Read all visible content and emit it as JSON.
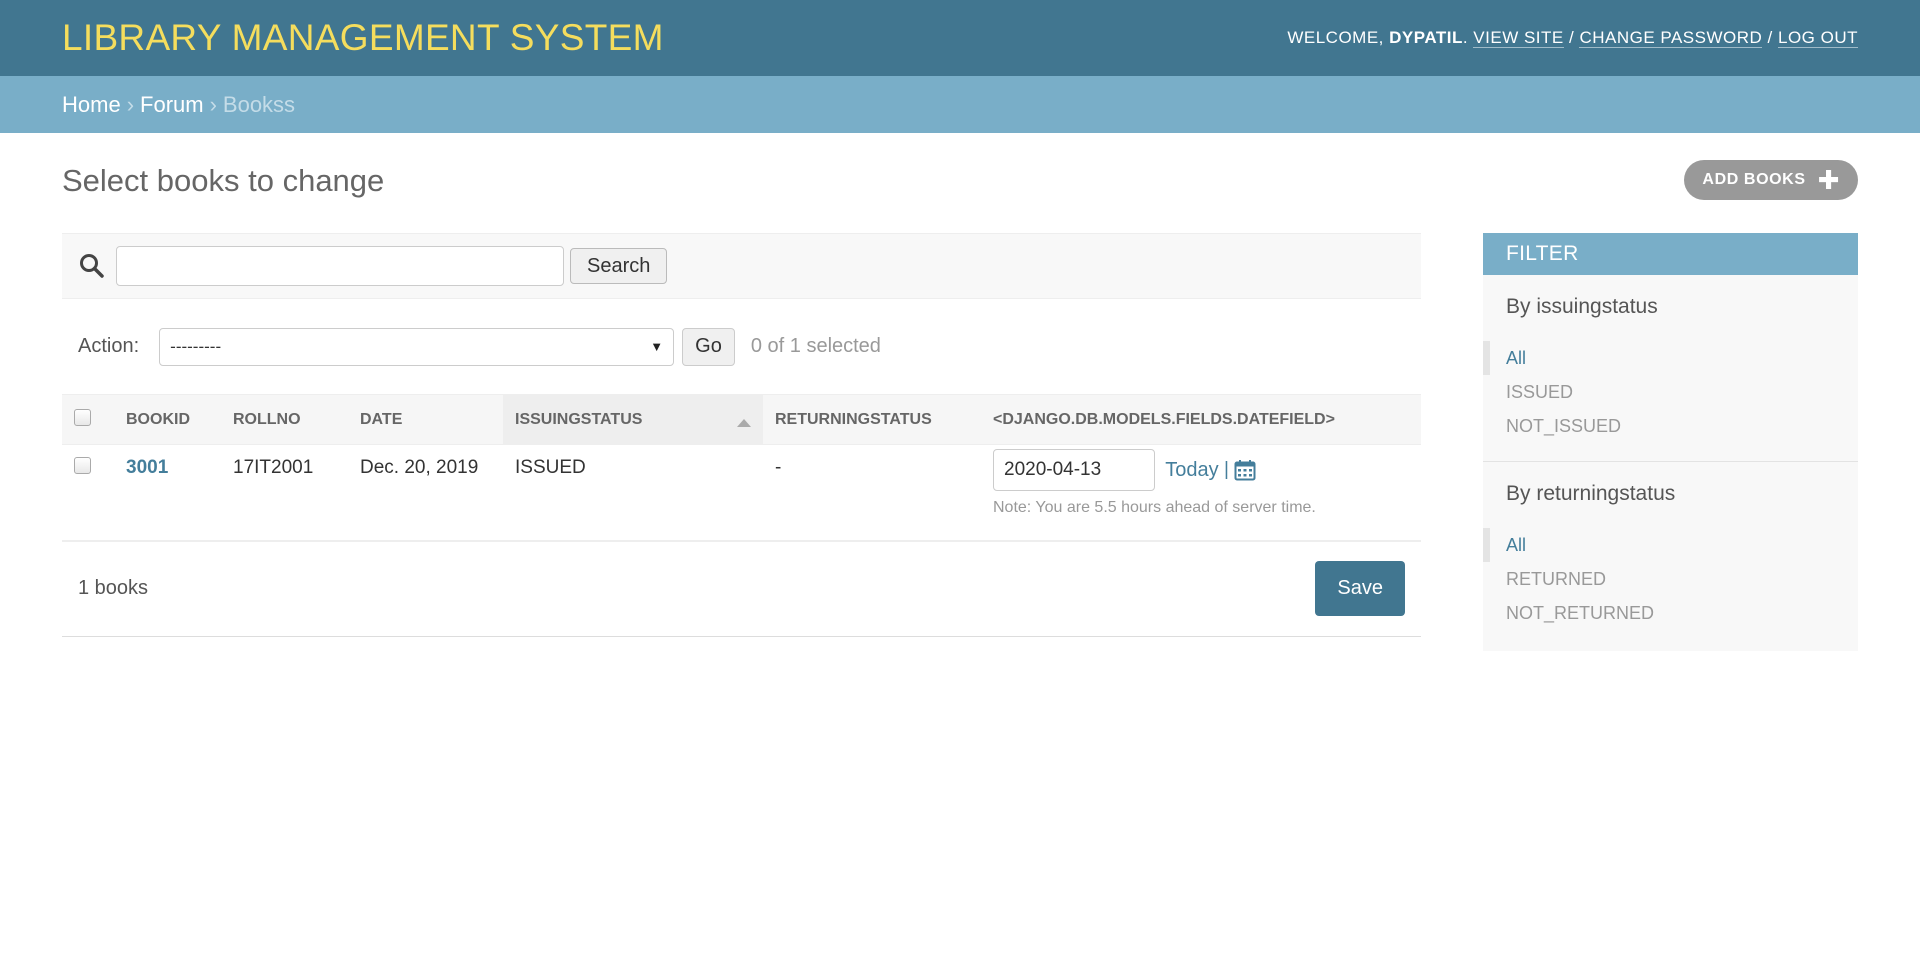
{
  "header": {
    "branding": "LIBRARY MANAGEMENT SYSTEM",
    "welcome": "WELCOME, ",
    "username": "DYPATIL",
    "view_site": "VIEW SITE",
    "change_password": "CHANGE PASSWORD",
    "log_out": "LOG OUT"
  },
  "breadcrumbs": {
    "home": "Home",
    "forum": "Forum",
    "current": "Bookss"
  },
  "page": {
    "title": "Select books to change",
    "add_button": "ADD BOOKS"
  },
  "search": {
    "value": "",
    "button": "Search"
  },
  "actions": {
    "label": "Action:",
    "selected_option": "---------",
    "go": "Go",
    "selected_count": "0 of 1 selected"
  },
  "table": {
    "columns": [
      "BOOKID",
      "ROLLNO",
      "DATE",
      "ISSUINGSTATUS",
      "RETURNINGSTATUS",
      "<DJANGO.DB.MODELS.FIELDS.DATEFIELD>"
    ],
    "rows": [
      {
        "bookid": "3001",
        "rollno": "17IT2001",
        "date": "Dec. 20, 2019",
        "issuingstatus": "ISSUED",
        "returningstatus": "-",
        "datefield": "2020-04-13",
        "today": "Today",
        "separator": "|",
        "note": "Note: You are 5.5 hours ahead of server time."
      }
    ]
  },
  "footer": {
    "result_count": "1 books",
    "save": "Save"
  },
  "filter": {
    "title": "FILTER",
    "groups": [
      {
        "heading": "By issuingstatus",
        "items": [
          "All",
          "ISSUED",
          "NOT_ISSUED"
        ]
      },
      {
        "heading": "By returningstatus",
        "items": [
          "All",
          "RETURNED",
          "NOT_RETURNED"
        ]
      }
    ]
  },
  "colors": {
    "header_bg": "#417690",
    "branding": "#f5dd5d",
    "breadcrumbs_bg": "#79aec8",
    "link": "#447e9b"
  },
  "icons": [
    "search-icon",
    "plus-icon",
    "calendar-icon",
    "dropdown-arrow-icon",
    "sort-ascending-icon"
  ]
}
